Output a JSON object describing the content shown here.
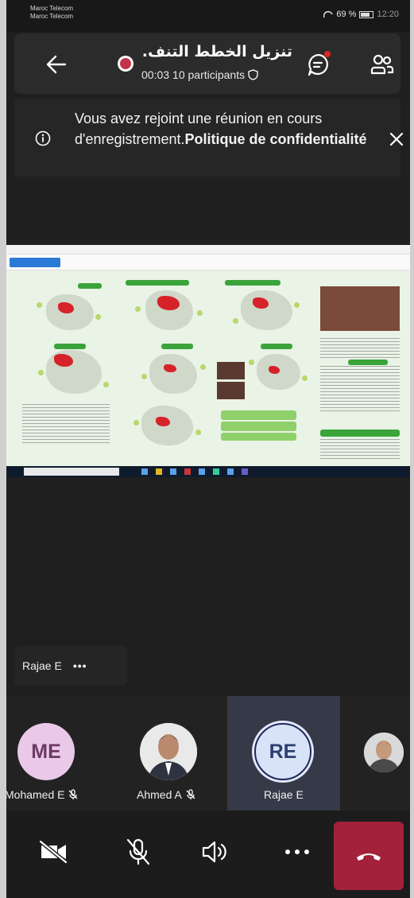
{
  "status_bar": {
    "carrier_line1": "Maroc Telecom",
    "carrier_line2": "Maroc Telecom",
    "battery": "69 %",
    "time": "12:20"
  },
  "header": {
    "title": "تنزيل الخطط التنف..",
    "duration": "00:03",
    "participants": "10 participants"
  },
  "banner": {
    "text": "Vous avez rejoint une réunion en cours d'enregistrement.",
    "link": "Politique de confidentialité"
  },
  "speaker": {
    "name": "Rajae E"
  },
  "participants": [
    {
      "initials": "ME",
      "name": "Mohamed E",
      "muted": true
    },
    {
      "initials": "",
      "name": "Ahmed A",
      "muted": true
    },
    {
      "initials": "RE",
      "name": "Rajae E",
      "muted": false,
      "active": true
    },
    {
      "initials": "",
      "name": "",
      "muted": false
    }
  ],
  "colors": {
    "background": "#1f1f1f",
    "recording": "#c4314b",
    "hangup": "#a3213a",
    "active_tile": "#363a48"
  },
  "icons": {
    "back": "arrow-left-icon",
    "chat": "chat-icon",
    "people": "people-icon",
    "info": "info-icon",
    "close": "close-icon",
    "camera_off": "camera-off-icon",
    "mic_off": "mic-off-icon",
    "speaker": "speaker-icon",
    "more": "more-icon",
    "hangup": "hangup-icon"
  }
}
